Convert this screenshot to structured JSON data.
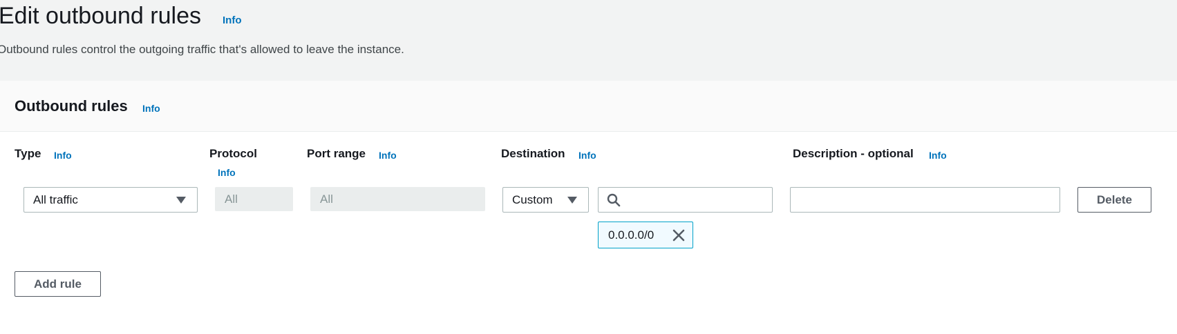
{
  "header": {
    "title": "Edit outbound rules",
    "info_label": "Info",
    "description": "Outbound rules control the outgoing traffic that's allowed to leave the instance."
  },
  "panel": {
    "title": "Outbound rules",
    "info_label": "Info",
    "columns": {
      "type": "Type",
      "protocol": "Protocol",
      "port_range": "Port range",
      "destination": "Destination",
      "description": "Description - optional"
    },
    "info_label_small": "Info",
    "rule": {
      "type_value": "All traffic",
      "protocol_value": "All",
      "port_range_value": "All",
      "destination_type": "Custom",
      "destination_search_value": "",
      "destination_token": "0.0.0.0/0",
      "description_value": ""
    },
    "delete_button": "Delete",
    "add_rule_button": "Add rule"
  },
  "colors": {
    "header_bg": "#f2f3f3",
    "link": "#0073bb",
    "token_border": "#00a1c9",
    "disabled_bg": "#eaeded"
  },
  "icons": {
    "dropdown": "caret-down-icon",
    "search": "search-icon",
    "remove": "close-icon"
  }
}
